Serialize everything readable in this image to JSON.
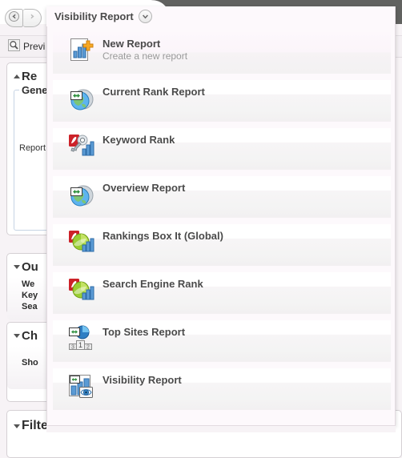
{
  "window": {
    "title": "Visibility Report"
  },
  "nav": {
    "back_icon": "arrow-left-icon",
    "forward_icon": "arrow-right-icon"
  },
  "toolbar": {
    "preview_label": "Previ",
    "preview_icon": "search-icon"
  },
  "dropdown": {
    "tab_label": "Visibility Report",
    "chevron_icon": "chevron-down-icon",
    "items": [
      {
        "title": "New Report",
        "subtitle": "Create a new report",
        "icon": "new-report-icon"
      },
      {
        "title": "Current Rank Report",
        "subtitle": "",
        "icon": "globe-report-icon"
      },
      {
        "title": "Keyword Rank",
        "subtitle": "",
        "icon": "pdf-key-chart-icon"
      },
      {
        "title": "Overview Report",
        "subtitle": "",
        "icon": "globe-report-icon"
      },
      {
        "title": "Rankings Box It (Global)",
        "subtitle": "",
        "icon": "pdf-leaf-chart-icon"
      },
      {
        "title": "Search Engine Rank",
        "subtitle": "",
        "icon": "pdf-leaf-chart-icon"
      },
      {
        "title": "Top Sites Report",
        "subtitle": "",
        "icon": "podium-pie-icon"
      },
      {
        "title": "Visibility Report",
        "subtitle": "",
        "icon": "chart-eye-icon"
      }
    ]
  },
  "form_panel": {
    "sections": [
      {
        "name": "report",
        "header": "Re",
        "arrow": "up",
        "legend": "Gene",
        "field_label": "Report"
      },
      {
        "name": "output",
        "header": "Ou",
        "arrow": "down",
        "lines": [
          "We",
          "Key",
          "Sea"
        ]
      },
      {
        "name": "chart",
        "header": "Ch",
        "arrow": "down",
        "lines": [
          "Sho"
        ]
      },
      {
        "name": "filters",
        "header": "Filters and conditions",
        "arrow": "down",
        "lines": []
      }
    ]
  },
  "colors": {
    "chrome_dark": "#616260",
    "panel_bg": "#fdf9fc",
    "page_bg": "#f7f3f6",
    "title_text": "#4a4a4a",
    "subtitle_text": "#9a9a9a",
    "accent_orange": "#f5a623",
    "pdf_red": "#cc2229",
    "chart_blue": "#3a7dc9",
    "globe_blue": "#4a9fdc",
    "leaf_green": "#8dc63f"
  }
}
